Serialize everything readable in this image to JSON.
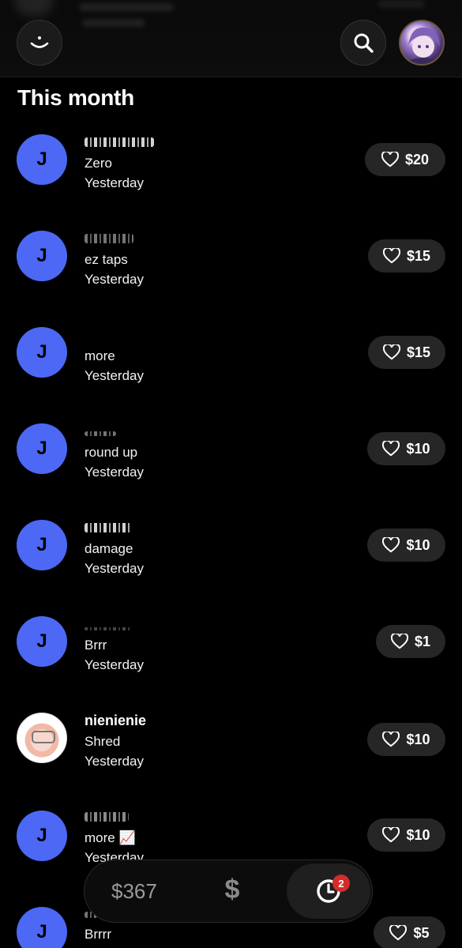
{
  "header": {
    "menu_icon": "smiley-icon",
    "search_icon": "search-icon",
    "profile_icon": "avatar"
  },
  "section": {
    "title": "This month"
  },
  "rows": [
    {
      "initial": "J",
      "name": "",
      "message": "Zero",
      "time": "Yesterday",
      "amount": "$20"
    },
    {
      "initial": "J",
      "name": "",
      "message": "ez taps",
      "time": "Yesterday",
      "amount": "$15"
    },
    {
      "initial": "J",
      "name": "",
      "message": "more",
      "time": "Yesterday",
      "amount": "$15"
    },
    {
      "initial": "J",
      "name": "",
      "message": "round up",
      "time": "Yesterday",
      "amount": "$10"
    },
    {
      "initial": "J",
      "name": "",
      "message": "damage",
      "time": "Yesterday",
      "amount": "$10"
    },
    {
      "initial": "J",
      "name": "",
      "message": "Brrr",
      "time": "Yesterday",
      "amount": "$1"
    },
    {
      "initial": "",
      "name": "nienienie",
      "message": "Shred",
      "time": "Yesterday",
      "amount": "$10"
    },
    {
      "initial": "J",
      "name": "",
      "message": "more 📈",
      "time": "Yesterday",
      "amount": "$10"
    },
    {
      "initial": "J",
      "name": "",
      "message": "Brrrr",
      "time": "",
      "amount": "$5"
    }
  ],
  "bottom_bar": {
    "balance": "$367",
    "dollar_label": "$",
    "activity_badge": "2"
  },
  "colors": {
    "avatar_blue": "#4c68f5",
    "button_bg": "#262626",
    "badge_red": "#d42b2b"
  }
}
